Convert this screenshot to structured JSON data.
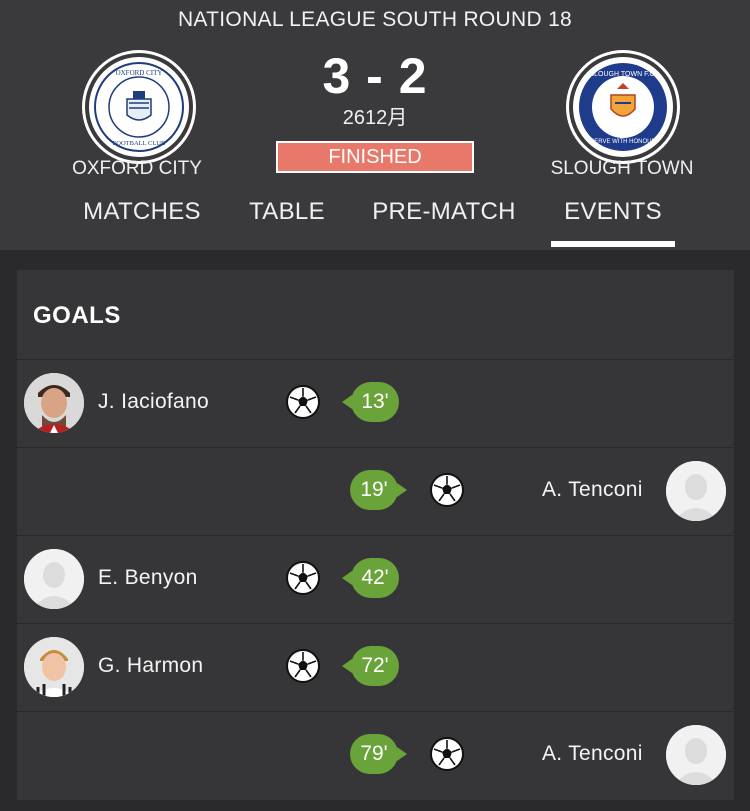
{
  "match": {
    "round": "NATIONAL LEAGUE SOUTH ROUND 18",
    "score": "3 - 2",
    "date": "2612月",
    "status": "FINISHED",
    "home_team": "OXFORD CITY",
    "away_team": "SLOUGH TOWN",
    "home_crest_icon": "oxford-city-crest",
    "away_crest_icon": "slough-town-crest"
  },
  "tabs": [
    {
      "label": "MATCHES",
      "active": false
    },
    {
      "label": "TABLE",
      "active": false
    },
    {
      "label": "PRE-MATCH",
      "active": false
    },
    {
      "label": "EVENTS",
      "active": true
    }
  ],
  "goals": {
    "title": "GOALS",
    "events": [
      {
        "player": "J. Iaciofano",
        "minute": "13'",
        "side": "home",
        "avatar": "player-photo"
      },
      {
        "player": "A. Tenconi",
        "minute": "19'",
        "side": "away",
        "avatar": "placeholder"
      },
      {
        "player": "E. Benyon",
        "minute": "42'",
        "side": "home",
        "avatar": "placeholder"
      },
      {
        "player": "G. Harmon",
        "minute": "72'",
        "side": "home",
        "avatar": "player-photo"
      },
      {
        "player": "A. Tenconi",
        "minute": "79'",
        "side": "away",
        "avatar": "placeholder"
      }
    ]
  },
  "colors": {
    "header_bg": "#3a3a3d",
    "page_bg": "#2a2a2c",
    "card_bg": "#363638",
    "finished_badge": "#e8796a",
    "minute_badge": "#6aa33a"
  }
}
